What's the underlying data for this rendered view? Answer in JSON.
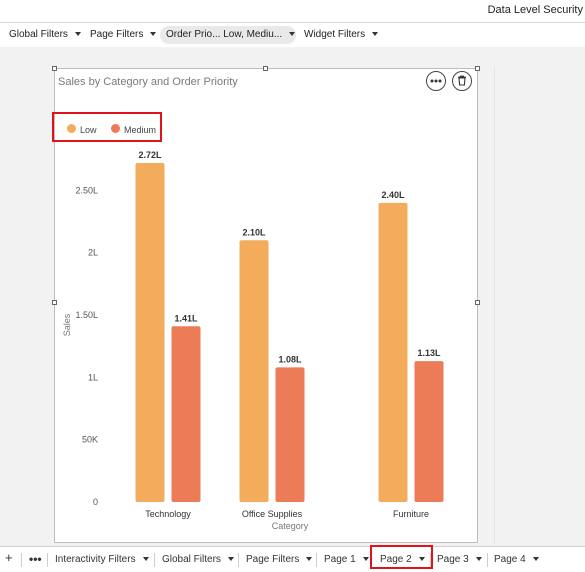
{
  "header": {
    "title": "Data Level Security"
  },
  "filters": [
    {
      "label": "Global Filters"
    },
    {
      "label": "Page Filters"
    },
    {
      "label": "Order Prio... Low, Mediu...",
      "active": true
    },
    {
      "label": "Widget Filters"
    }
  ],
  "widget": {
    "title": "Sales by Category and Order Priority",
    "more_icon": "more-horizontal-icon",
    "delete_icon": "trash-icon"
  },
  "chart_data": {
    "type": "bar",
    "title": "Sales by Category and Order Priority",
    "xlabel": "Category",
    "ylabel": "Sales",
    "categories": [
      "Technology",
      "Office Supplies",
      "Furniture"
    ],
    "series": [
      {
        "name": "Low",
        "color": "#f2ac5c",
        "values": [
          272000,
          210000,
          240000
        ],
        "labels": [
          "2.72L",
          "2.10L",
          "2.40L"
        ]
      },
      {
        "name": "Medium",
        "color": "#ec7b57",
        "values": [
          141000,
          108000,
          113000
        ],
        "labels": [
          "1.41L",
          "1.08L",
          "1.13L"
        ]
      }
    ],
    "yticks": [
      0,
      50000,
      100000,
      150000,
      200000,
      250000
    ],
    "ytick_labels": [
      "0",
      "50K",
      "1L",
      "1.50L",
      "2L",
      "2.50L"
    ],
    "ylim": [
      0,
      272000
    ],
    "grid": false,
    "legend": "top-left"
  },
  "tabs": {
    "add_icon": "plus-icon",
    "more_icon": "more-horizontal-icon",
    "items": [
      {
        "label": "Interactivity Filters"
      },
      {
        "label": "Global Filters"
      },
      {
        "label": "Page Filters"
      },
      {
        "label": "Page 1"
      },
      {
        "label": "Page 2",
        "active": true
      },
      {
        "label": "Page 3"
      },
      {
        "label": "Page 4"
      }
    ]
  }
}
